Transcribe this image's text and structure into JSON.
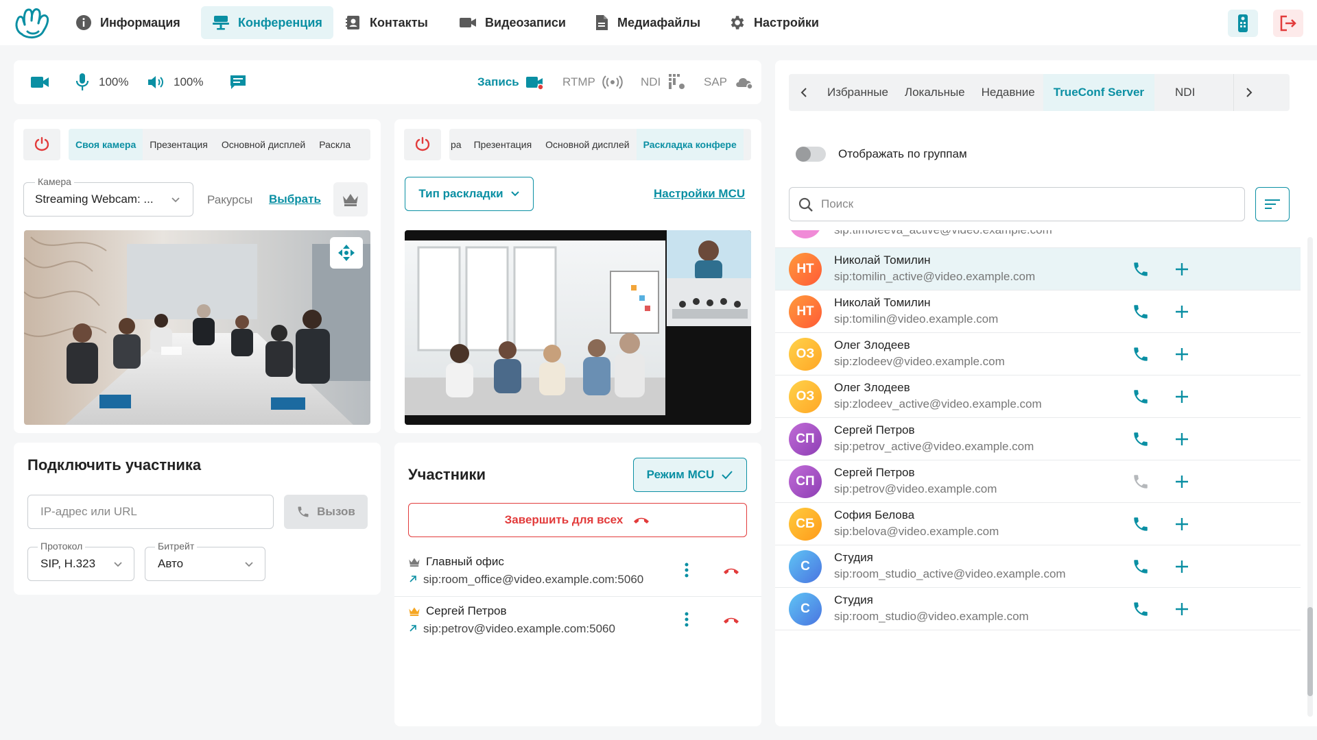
{
  "nav": {
    "items": [
      {
        "label": "Информация",
        "icon": "info-icon"
      },
      {
        "label": "Конференция",
        "icon": "conference-icon",
        "active": true
      },
      {
        "label": "Контакты",
        "icon": "contacts-icon"
      },
      {
        "label": "Видеозаписи",
        "icon": "video-recordings-icon"
      },
      {
        "label": "Медиафайлы",
        "icon": "media-files-icon"
      },
      {
        "label": "Настройки",
        "icon": "gear-icon"
      }
    ]
  },
  "toolbar": {
    "mic_level": "100%",
    "speaker_level": "100%",
    "record_label": "Запись",
    "rtmp_label": "RTMP",
    "ndi_label": "NDI",
    "sap_label": "SAP"
  },
  "camera_panel": {
    "tabs": [
      "Своя камера",
      "Презентация",
      "Основной дисплей",
      "Раскла"
    ],
    "active_tab": 0,
    "camera_field_label": "Камера",
    "camera_value": "Streaming Webcam: ...",
    "angles_label": "Ракурсы",
    "choose_link": "Выбрать"
  },
  "layout_panel": {
    "tabs": [
      "ра",
      "Презентация",
      "Основной дисплей",
      "Раскладка конфере"
    ],
    "active_tab": 3,
    "layout_type_button": "Тип раскладки",
    "mcu_settings_link": "Настройки MCU"
  },
  "connect_panel": {
    "title": "Подключить участника",
    "address_placeholder": "IP-адрес или URL",
    "call_button": "Вызов",
    "protocol_label": "Протокол",
    "protocol_value": "SIP, H.323",
    "bitrate_label": "Битрейт",
    "bitrate_value": "Авто"
  },
  "participants_panel": {
    "title": "Участники",
    "mcu_mode_button": "Режим MCU",
    "end_all_button": "Завершить для всех",
    "participants": [
      {
        "name": "Главный офис",
        "sip": "sip:room_office@video.example.com:5060",
        "crown": "gray"
      },
      {
        "name": "Сергей Петров",
        "sip": "sip:petrov@video.example.com:5060",
        "crown": "orange"
      }
    ]
  },
  "contacts_panel": {
    "tabs": [
      "Избранные",
      "Локальные",
      "Недавние",
      "TrueConf Server",
      "NDI"
    ],
    "active_tab": 3,
    "group_toggle_label": "Отображать по группам",
    "search_placeholder": "Поиск",
    "partial_top_sip": "sip:timofeeva_active@video.example.com",
    "contacts": [
      {
        "initials": "НТ",
        "name": "Николай Томилин",
        "sip": "sip:tomilin_active@video.example.com",
        "color_a": "#ff9a3c",
        "color_b": "#ff5a36",
        "call_enabled": true,
        "highlighted": true
      },
      {
        "initials": "НТ",
        "name": "Николай Томилин",
        "sip": "sip:tomilin@video.example.com",
        "color_a": "#ff9a3c",
        "color_b": "#ff5a36",
        "call_enabled": true
      },
      {
        "initials": "ОЗ",
        "name": "Олег Злодеев",
        "sip": "sip:zlodeev@video.example.com",
        "color_a": "#ffd24a",
        "color_b": "#ffa726",
        "call_enabled": true
      },
      {
        "initials": "ОЗ",
        "name": "Олег Злодеев",
        "sip": "sip:zlodeev_active@video.example.com",
        "color_a": "#ffd24a",
        "color_b": "#ffa726",
        "call_enabled": true
      },
      {
        "initials": "СП",
        "name": "Сергей Петров",
        "sip": "sip:petrov_active@video.example.com",
        "color_a": "#c06bd6",
        "color_b": "#8e3fb5",
        "call_enabled": true
      },
      {
        "initials": "СП",
        "name": "Сергей Петров",
        "sip": "sip:petrov@video.example.com",
        "color_a": "#c06bd6",
        "color_b": "#8e3fb5",
        "call_enabled": false
      },
      {
        "initials": "СБ",
        "name": "София Белова",
        "sip": "sip:belova@video.example.com",
        "color_a": "#ffcb3d",
        "color_b": "#ff9b1a",
        "call_enabled": true
      },
      {
        "initials": "С",
        "name": "Студия",
        "sip": "sip:room_studio_active@video.example.com",
        "color_a": "#5fc4f5",
        "color_b": "#4a74e0",
        "call_enabled": true
      },
      {
        "initials": "С",
        "name": "Студия",
        "sip": "sip:room_studio@video.example.com",
        "color_a": "#5fc4f5",
        "color_b": "#4a74e0",
        "call_enabled": true
      }
    ]
  },
  "colors": {
    "accent": "#0a8fa3",
    "danger": "#e23b3b"
  }
}
